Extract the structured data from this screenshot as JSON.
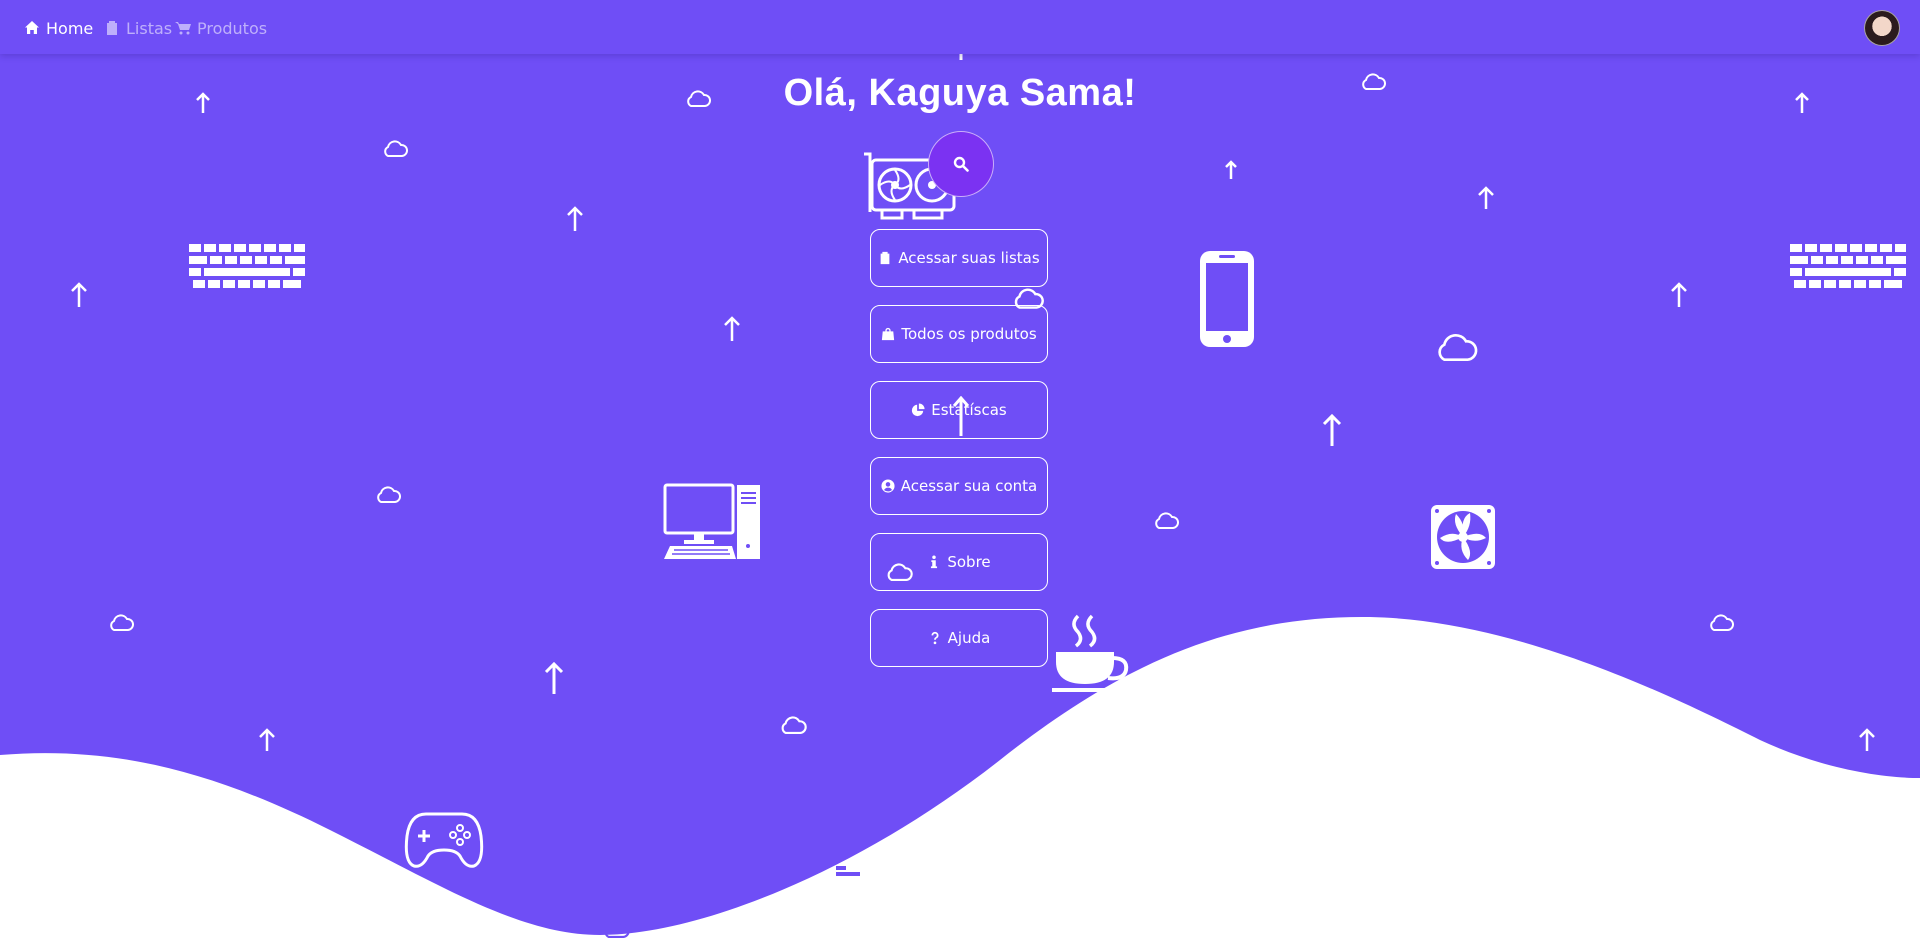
{
  "nav": {
    "items": [
      {
        "label": "Home",
        "icon": "home-icon",
        "active": true
      },
      {
        "label": "Listas",
        "icon": "clipboard-icon",
        "active": false
      },
      {
        "label": "Produtos",
        "icon": "cart-icon",
        "active": false
      }
    ],
    "avatar": "user-avatar"
  },
  "main": {
    "greeting": "Olá, Kaguya Sama!",
    "search_icon": "search-icon",
    "buttons": [
      {
        "label": "Acessar suas listas",
        "icon": "clipboard-icon"
      },
      {
        "label": "Todos os produtos",
        "icon": "shopping-bag-icon"
      },
      {
        "label": "Estatíscas",
        "icon": "pie-chart-icon"
      },
      {
        "label": "Acessar sua conta",
        "icon": "user-circle-icon"
      },
      {
        "label": "Sobre",
        "icon": "info-icon"
      },
      {
        "label": "Ajuda",
        "icon": "question-icon"
      }
    ]
  },
  "colors": {
    "background": "#6f4ef6",
    "accent": "#7b32f2",
    "wave": "#ffffff"
  }
}
